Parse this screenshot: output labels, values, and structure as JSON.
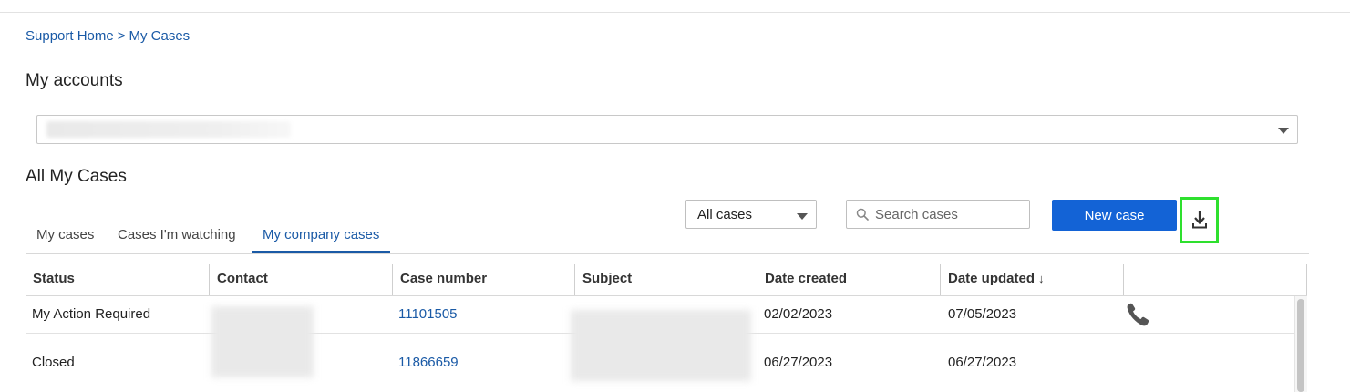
{
  "breadcrumb": {
    "home": "Support Home",
    "separator": ">",
    "current": "My Cases"
  },
  "accounts": {
    "title": "My accounts"
  },
  "cases": {
    "title": "All My Cases",
    "filter_value": "All cases",
    "search_placeholder": "Search cases",
    "new_case_label": "New case"
  },
  "tabs": [
    {
      "label": "My cases",
      "active": false
    },
    {
      "label": "Cases I'm watching",
      "active": false
    },
    {
      "label": "My company cases",
      "active": true
    }
  ],
  "table": {
    "headers": [
      "Status",
      "Contact",
      "Case number",
      "Subject",
      "Date created",
      "Date updated"
    ],
    "sort_indicator": "↓",
    "rows": [
      {
        "status": "My Action Required",
        "case_number": "11101505",
        "date_created": "02/02/2023",
        "date_updated": "07/05/2023",
        "has_phone": true
      },
      {
        "status": "Closed",
        "case_number": "11866659",
        "date_created": "06/27/2023",
        "date_updated": "06/27/2023",
        "has_phone": false
      }
    ]
  },
  "icons": {
    "download": "download-icon",
    "search": "search-icon",
    "phone": "phone-icon",
    "dropdown": "chevron-down-icon"
  },
  "colors": {
    "link": "#1a5aa6",
    "primary_button": "#1363d6",
    "highlight_border": "#2ee02e"
  }
}
